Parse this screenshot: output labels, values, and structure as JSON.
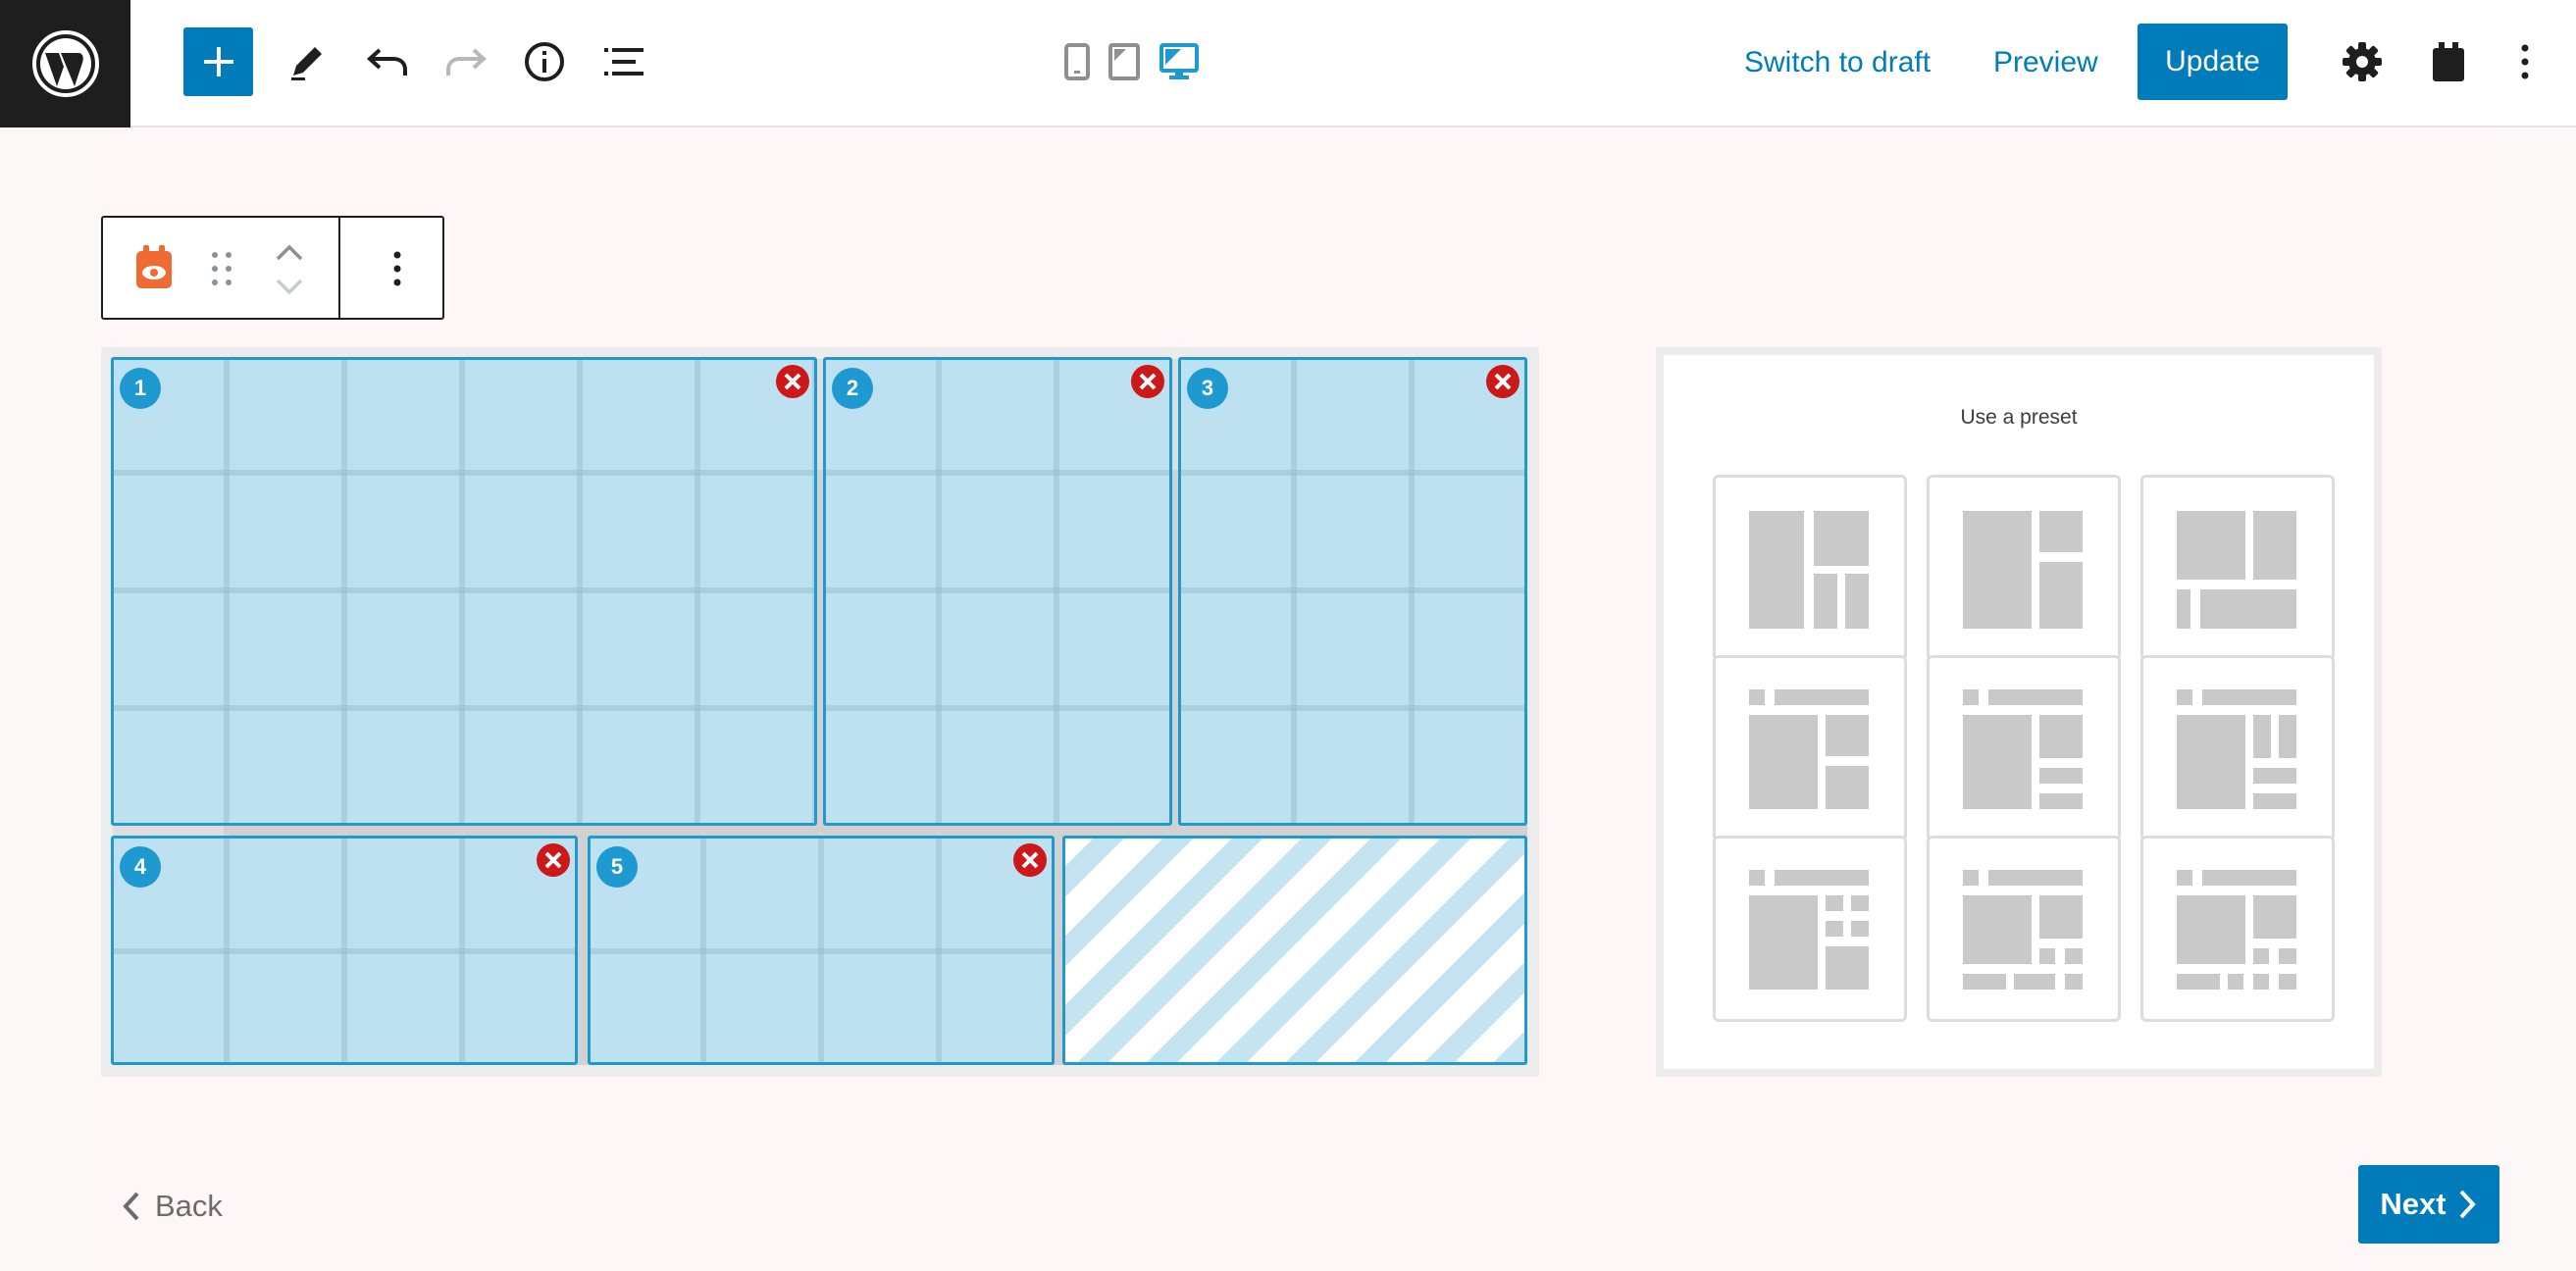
{
  "topbar": {
    "switch_to_draft": "Switch to draft",
    "preview": "Preview",
    "update": "Update"
  },
  "colors": {
    "accent": "#007cba",
    "area_fill": "#bde1f0",
    "area_border": "#1e9ad1",
    "remove_red": "#cc1818",
    "block_icon_orange": "#f06b34"
  },
  "grid": {
    "areas": [
      {
        "number": "1"
      },
      {
        "number": "2"
      },
      {
        "number": "3"
      },
      {
        "number": "4"
      },
      {
        "number": "5"
      }
    ]
  },
  "preset_panel": {
    "title": "Use a preset"
  },
  "nav": {
    "back": "Back",
    "next": "Next"
  }
}
